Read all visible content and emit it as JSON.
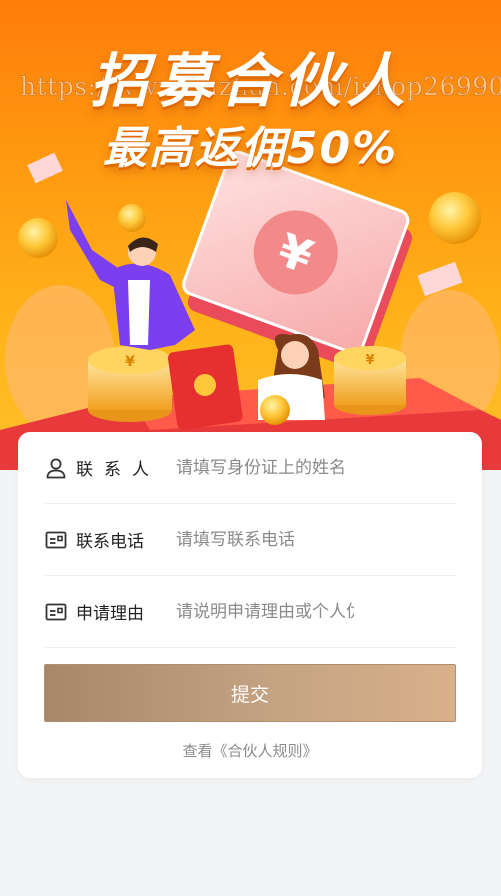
{
  "banner": {
    "headline": "招募合伙人",
    "subheadline": "最高返佣50%",
    "watermark": "https://www.huzhan.com/ishop26990"
  },
  "form": {
    "fields": [
      {
        "label": "联系人",
        "placeholder": "请填写身份证上的姓名",
        "value": "",
        "icon": "person-icon"
      },
      {
        "label": "联系电话",
        "placeholder": "请填写联系电话",
        "value": "",
        "icon": "id-card-icon"
      },
      {
        "label": "申请理由",
        "placeholder": "请说明申请理由或个人优势",
        "value": "",
        "icon": "id-card-icon"
      }
    ],
    "submit_label": "提交",
    "rules_link": "查看《合伙人规则》"
  },
  "colors": {
    "banner_orange": "#ff8a0c",
    "button_gradient_start": "#a88668",
    "button_gradient_end": "#d9b08a",
    "page_background": "#f3f4f6"
  }
}
